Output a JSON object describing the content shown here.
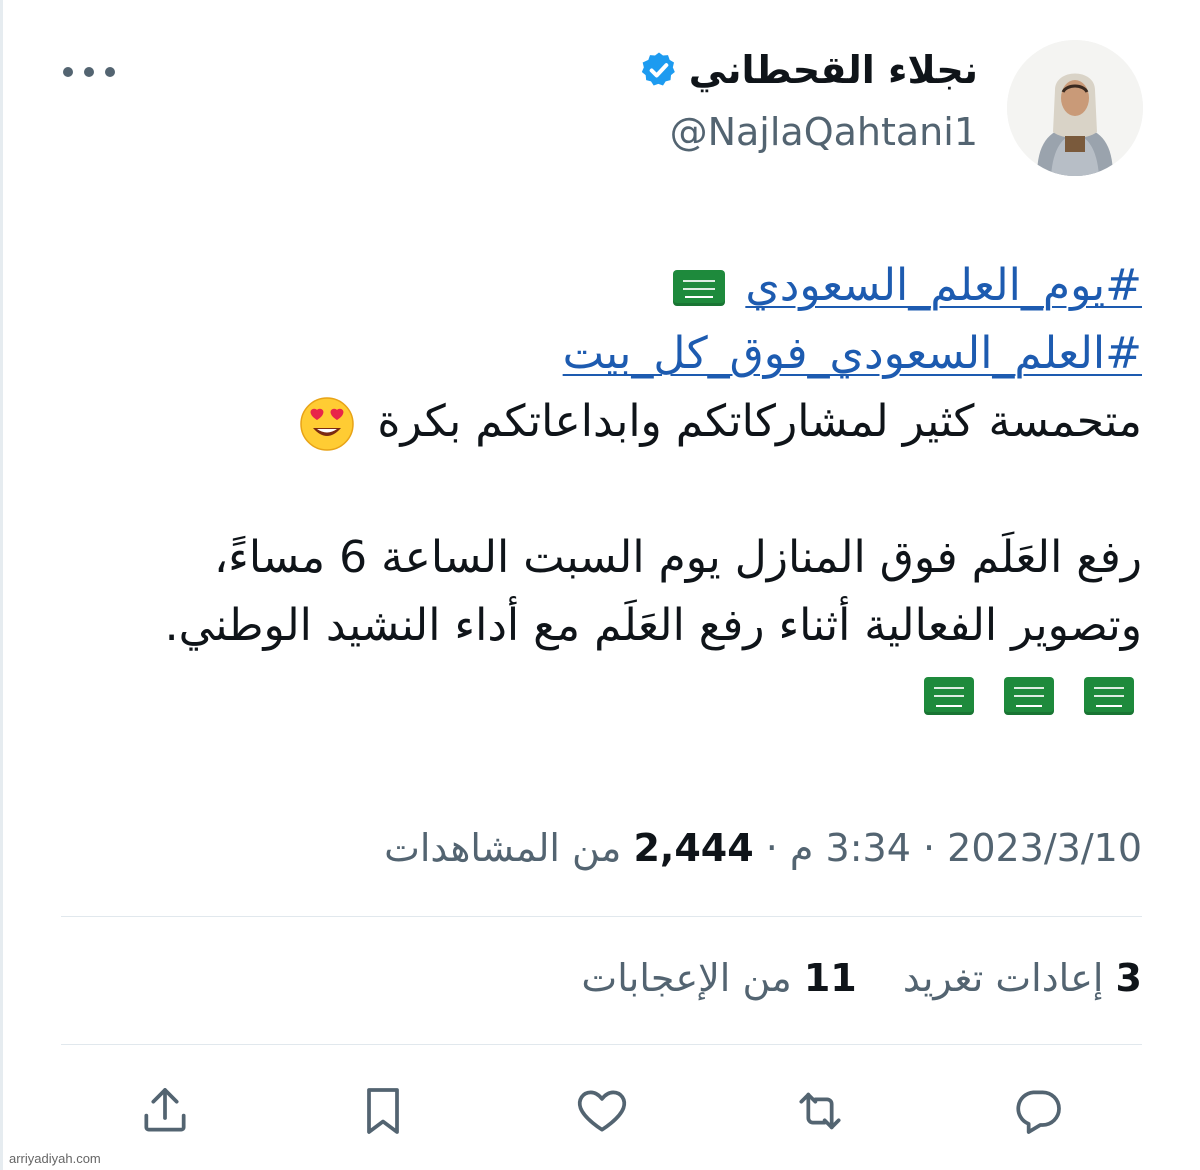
{
  "author": {
    "display_name": "نجلاء القحطاني",
    "handle": "@NajlaQahtani1",
    "verified": true
  },
  "tweet": {
    "hashtag_1": "#يوم_العلم_السعودي",
    "hashtag_2": "#العلم_السعودي_فوق_كل_بيت",
    "line_3": "متحمسة كثير لمشاركاتكم وابداعاتكم بكرة",
    "line_4": "رفع العَلَم فوق المنازل يوم السبت الساعة 6 مساءً،",
    "line_5": "وتصوير الفعالية أثناء رفع العَلَم مع أداء النشيد الوطني."
  },
  "meta": {
    "date": "2023/3/10",
    "time": "3:34 م",
    "separator": "·",
    "views_count": "2,444",
    "views_label": "من المشاهدات"
  },
  "stats": {
    "retweets_count": "3",
    "retweets_label": "إعادات تغريد",
    "likes_count": "11",
    "likes_label": "من الإعجابات"
  },
  "icons": {
    "more": "more-icon",
    "verified": "verified-badge-icon",
    "reply": "reply-icon",
    "retweet": "retweet-icon",
    "like": "heart-icon",
    "bookmark": "bookmark-icon",
    "share": "share-icon"
  },
  "colors": {
    "text": "#0f1419",
    "secondary": "#536471",
    "link": "#1d5bb0",
    "verified": "#1d9bf0",
    "flag_green": "#1e8a3c"
  },
  "watermark": "arriyadiyah.com"
}
